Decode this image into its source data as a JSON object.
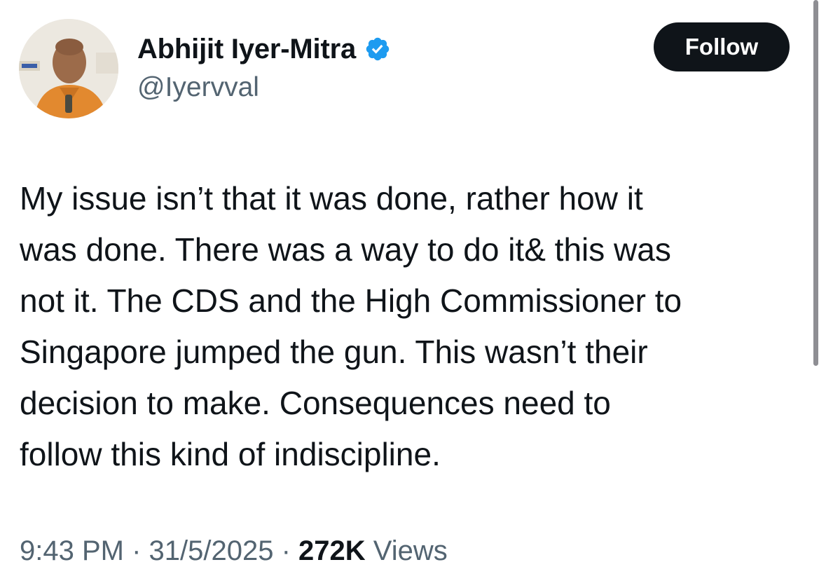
{
  "author": {
    "display_name": "Abhijit Iyer-Mitra",
    "handle": "@Iyervval",
    "verified": true,
    "avatar_icon": "profile-photo",
    "verified_icon": "verified-badge-icon"
  },
  "follow_button": {
    "label": "Follow"
  },
  "tweet": {
    "lines": [
      "My issue isn’t that it was done, rather how it",
      "was done. There was a way to do it& this was",
      "not it. The CDS and the High Commissioner to",
      "Singapore jumped the gun. This wasn’t their",
      "decision to make. Consequences need to",
      "follow this kind of indiscipline."
    ]
  },
  "meta": {
    "time": "9:43 PM",
    "separator": " · ",
    "date": "31/5/2025",
    "views_count": "272K",
    "views_label": "Views"
  },
  "colors": {
    "text_primary": "#0f1419",
    "text_secondary": "#536471",
    "verified_blue": "#1d9bf0",
    "button_bg": "#0f1419",
    "button_text": "#ffffff"
  }
}
